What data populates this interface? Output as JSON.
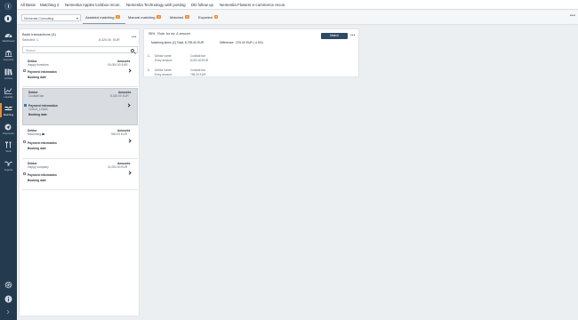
{
  "sidebar": {
    "items": [
      {
        "label": "Dashboard",
        "icon": "dashboard-icon"
      },
      {
        "label": "Accounts",
        "icon": "bank-icon"
      },
      {
        "label": "Archive",
        "icon": "archive-icon"
      },
      {
        "label": "Liquidity",
        "icon": "liquidity-chart-icon"
      },
      {
        "label": "Matching",
        "icon": "matching-icon"
      },
      {
        "label": "Payments",
        "icon": "payments-icon"
      },
      {
        "label": "Tools",
        "icon": "tools-icon"
      },
      {
        "label": "Imports",
        "icon": "imports-icon"
      }
    ]
  },
  "top_tabs": [
    "All Basis",
    "Matching 2",
    "Nementia Apples lockbox recon.",
    "Nementia Technology with posting",
    "DD follow up",
    "Nementia Flowers e-commerce recon."
  ],
  "subbar": {
    "entity": "Nementia Consulting",
    "tabs": [
      {
        "label": "Assisted matching",
        "badge": "2",
        "active": true
      },
      {
        "label": "Manual matching",
        "badge": "3",
        "active": false
      },
      {
        "label": "Matched",
        "badge": "9",
        "active": false
      },
      {
        "label": "Exported",
        "badge": "9",
        "active": false
      }
    ]
  },
  "bank_panel": {
    "title": "Bank transactions (4)",
    "selected": "Selected: 1",
    "total": "8,420.00",
    "currency": "EUR",
    "search_placeholder": "Search",
    "cards": [
      {
        "k1": "Debtor",
        "v1": "Happy investors",
        "k2": "Amounts",
        "v2": "94,000.00 EUR",
        "k3": "Payment information",
        "v3": "",
        "k4": "Booking date",
        "checked": false,
        "selected": false
      },
      {
        "k1": "Debtor",
        "v1": "Cocktail bar",
        "k2": "Amounts",
        "v2": "8,420.00 EUR",
        "k3": "Payment information",
        "v3": "123US_123AK",
        "k4": "Booking date",
        "checked": true,
        "selected": true
      },
      {
        "k1": "Debtor",
        "v1": "Machining",
        "k2": "Amounts",
        "v2": "960.00 EUR",
        "k3": "Payment information",
        "v3": "",
        "k4": "Booking date",
        "checked": false,
        "selected": false
      },
      {
        "k1": "Debtor",
        "v1": "Happy company",
        "k2": "Amounts",
        "v2": "11,000.00 EUR",
        "k3": "Payment information",
        "v3": "",
        "k4": "Booking date",
        "checked": false,
        "selected": false
      }
    ]
  },
  "match_panel": {
    "title": "95% · Rule: for inv. & amount",
    "match_label": "Match",
    "summary": "Matching items (2)  Total: 8,795.00 EUR",
    "difference": "Difference:  -375.00 EUR ( 4.3%)",
    "entries": [
      {
        "num": "1.",
        "l1": "Debtor name:",
        "v1": "Cocktail bar",
        "l2": "Entry amount:",
        "v2": "8,000.00 EUR"
      },
      {
        "num": "2.",
        "l1": "Debtor name:",
        "v1": "Cocktail bar",
        "l2": "Entry amount:",
        "v2": "795.00 EUR"
      }
    ]
  },
  "colors": {
    "sidebar": "#243a4f",
    "accent": "#f08a2e",
    "button": "#2f4a63"
  }
}
